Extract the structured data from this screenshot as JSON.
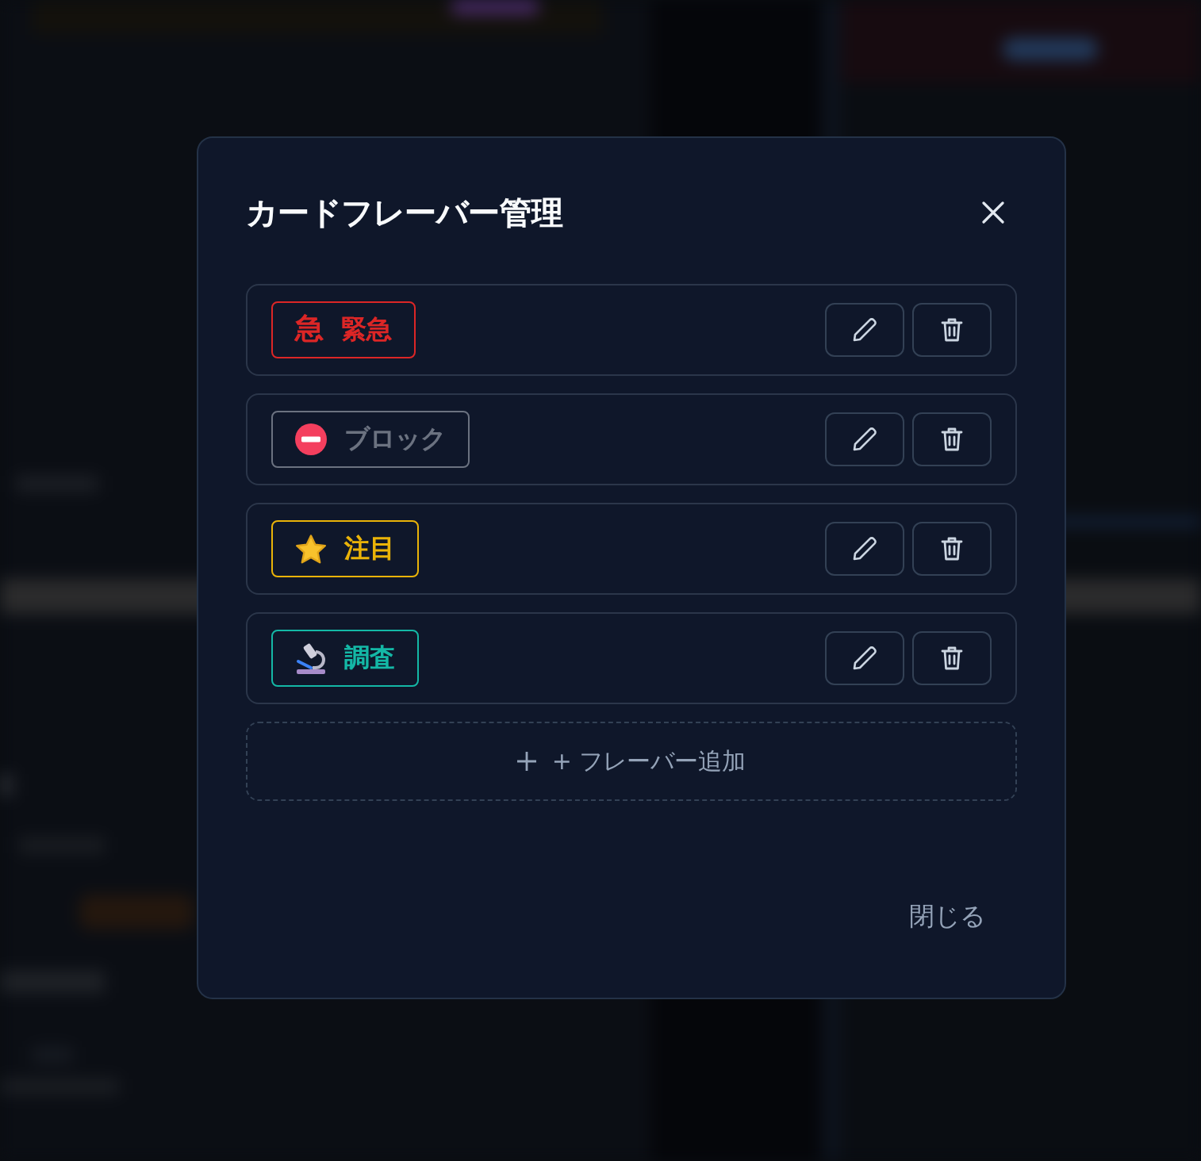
{
  "dialog": {
    "title": "カードフレーバー管理"
  },
  "flavors": [
    {
      "kind": "character",
      "symbol": "急",
      "label": "緊急",
      "color": "#dc2626"
    },
    {
      "kind": "no-entry",
      "label": "ブロック",
      "color": "#6b7280"
    },
    {
      "kind": "star",
      "label": "注目",
      "color": "#eab308"
    },
    {
      "kind": "microscope",
      "label": "調査",
      "color": "#14b8a6"
    }
  ],
  "add_button": {
    "label": "+ フレーバー追加"
  },
  "footer": {
    "close_button": "閉じる"
  }
}
